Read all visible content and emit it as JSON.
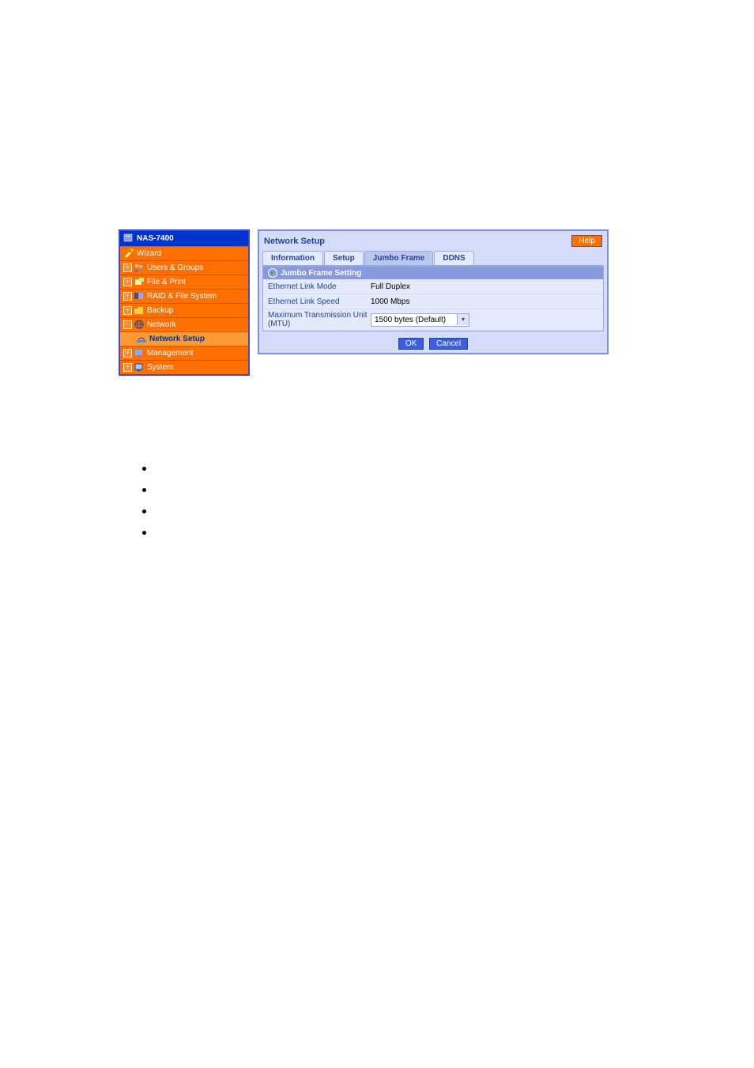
{
  "sidebar": {
    "title": "NAS-7400",
    "items": [
      {
        "label": "Wizard",
        "expand": false
      },
      {
        "label": "Users & Groups",
        "expand": true
      },
      {
        "label": "File & Print",
        "expand": true
      },
      {
        "label": "RAID & File System",
        "expand": true
      },
      {
        "label": "Backup",
        "expand": true
      },
      {
        "label": "Network",
        "expand": false,
        "expanded": true,
        "sub": [
          {
            "label": "Network Setup"
          }
        ]
      },
      {
        "label": "Management",
        "expand": true
      },
      {
        "label": "System",
        "expand": true
      }
    ]
  },
  "main": {
    "title": "Network Setup",
    "help": "Help",
    "tabs": [
      {
        "label": "Information"
      },
      {
        "label": "Setup"
      },
      {
        "label": "Jumbo Frame",
        "active": true
      },
      {
        "label": "DDNS"
      }
    ],
    "section": "Jumbo Frame Setting",
    "rows": [
      {
        "label": "Ethernet Link Mode",
        "value": "Full Duplex",
        "type": "text"
      },
      {
        "label": "Ethernet Link Speed",
        "value": "1000 Mbps",
        "type": "text"
      },
      {
        "label": "Maximum Transmission Unit (MTU)",
        "value": "1500 bytes (Default)",
        "type": "select"
      }
    ],
    "ok": "OK",
    "cancel": "Cancel"
  }
}
